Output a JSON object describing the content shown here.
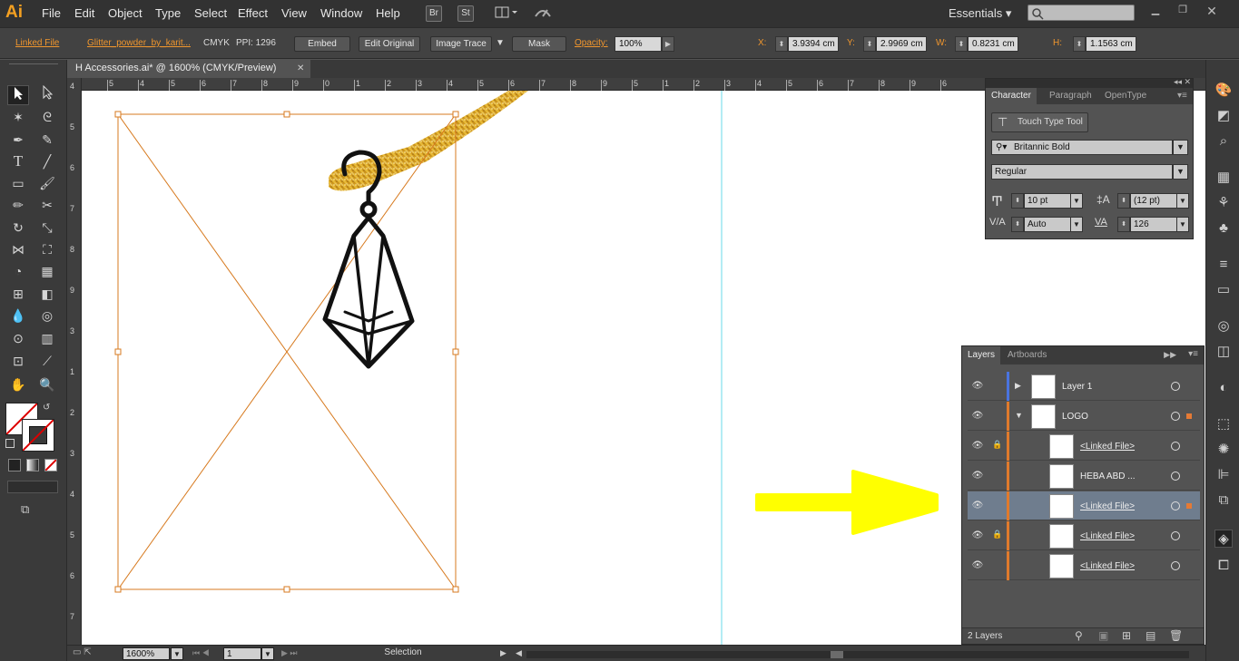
{
  "app": {
    "logo": "Ai"
  },
  "menu": [
    "File",
    "Edit",
    "Object",
    "Type",
    "Select",
    "Effect",
    "View",
    "Window",
    "Help"
  ],
  "menubar_buttons": {
    "br": "Br",
    "st": "St"
  },
  "workspace": "Essentials",
  "control": {
    "linked_file": "Linked File",
    "file_name": "Glitter_powder_by_karit...",
    "color_mode": "CMYK",
    "ppi": "PPI: 1296",
    "embed": "Embed",
    "edit_original": "Edit Original",
    "image_trace": "Image Trace",
    "mask": "Mask",
    "opacity_label": "Opacity:",
    "opacity_value": "100%",
    "x_label": "X:",
    "x_value": "3.9394 cm",
    "y_label": "Y:",
    "y_value": "2.9969 cm",
    "w_label": "W:",
    "w_value": "0.8231 cm",
    "h_label": "H:",
    "h_value": "1.1563 cm"
  },
  "document_tab": {
    "title": "H Accessories.ai* @ 1600% (CMYK/Preview)"
  },
  "rulers": {
    "top": [
      "5",
      "4",
      "5",
      "6",
      "7",
      "8",
      "9",
      "0",
      "1",
      "2",
      "3",
      "4",
      "5",
      "6",
      "7",
      "8",
      "9",
      "5",
      "1",
      "2",
      "3",
      "4",
      "5",
      "6",
      "7",
      "8",
      "9",
      "6"
    ],
    "left": [
      "4",
      "5",
      "6",
      "7",
      "8",
      "9",
      "3",
      "1",
      "2",
      "3",
      "4",
      "5",
      "6",
      "7"
    ]
  },
  "character_panel": {
    "tabs": [
      "Character",
      "Paragraph",
      "OpenType"
    ],
    "touch_type_tool": "Touch Type Tool",
    "font_family": "Britannic Bold",
    "font_style": "Regular",
    "font_size": "10 pt",
    "leading": "(12 pt)",
    "kerning": "Auto",
    "tracking": "126"
  },
  "layers_panel": {
    "tabs": [
      "Layers",
      "Artboards"
    ],
    "rows": [
      {
        "name": "Layer 1",
        "color": "#4a74e0"
      },
      {
        "name": "LOGO",
        "color": "#e07a2c"
      },
      {
        "name": "<Linked File>",
        "color": "#e07a2c"
      },
      {
        "name": "HEBA ABD ...",
        "color": "#e07a2c"
      },
      {
        "name": "<Linked File>",
        "color": "#e07a2c"
      },
      {
        "name": "<Linked File>",
        "color": "#e07a2c"
      },
      {
        "name": "<Linked File>",
        "color": "#e07a2c"
      }
    ],
    "count": "2 Layers"
  },
  "status": {
    "zoom": "1600%",
    "artboard": "1",
    "tool": "Selection"
  },
  "colors": {
    "accent": "#f0962d",
    "selection": "#d77a1f",
    "guide": "#67d9ea",
    "arrow": "#ffff00"
  }
}
